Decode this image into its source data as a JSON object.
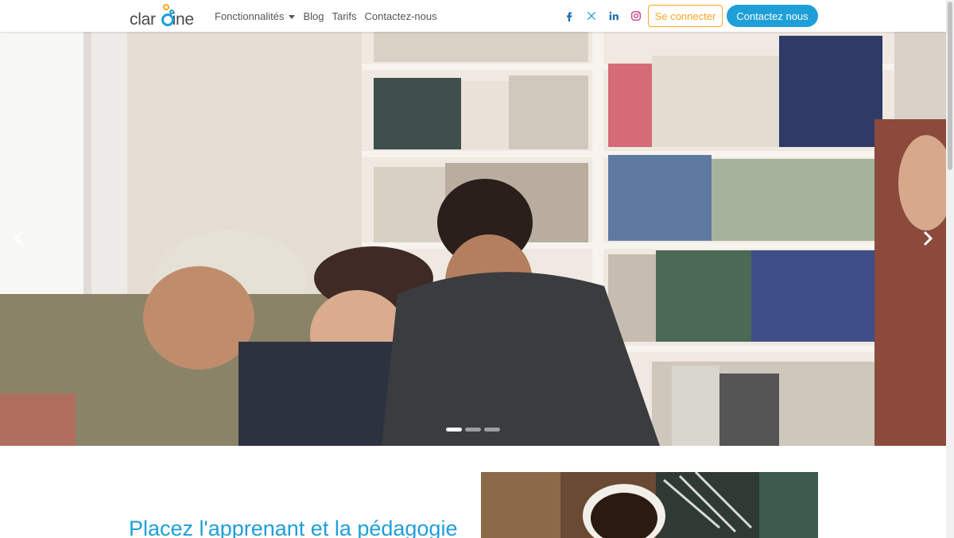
{
  "brand": {
    "logo_text": "clar·line",
    "logo_alt": "Claroline"
  },
  "nav": {
    "items": [
      {
        "label": "Fonctionnalités",
        "has_dropdown": true
      },
      {
        "label": "Blog"
      },
      {
        "label": "Tarifs"
      },
      {
        "label": "Contactez-nous"
      }
    ]
  },
  "socials": [
    {
      "icon": "facebook-icon"
    },
    {
      "icon": "x-twitter-icon"
    },
    {
      "icon": "linkedin-icon"
    },
    {
      "icon": "instagram-icon"
    }
  ],
  "actions": {
    "login_label": "Se connecter",
    "contact_label": "Contactez nous"
  },
  "carousel": {
    "slide_count": 3,
    "active_index": 0,
    "prev_icon": "chevron-left-icon",
    "next_icon": "chevron-right-icon"
  },
  "content": {
    "headline": "Placez l'apprenant et la pédagogie"
  },
  "colors": {
    "primary": "#1e9fd8",
    "accent": "#f5a623",
    "text": "#555555"
  }
}
